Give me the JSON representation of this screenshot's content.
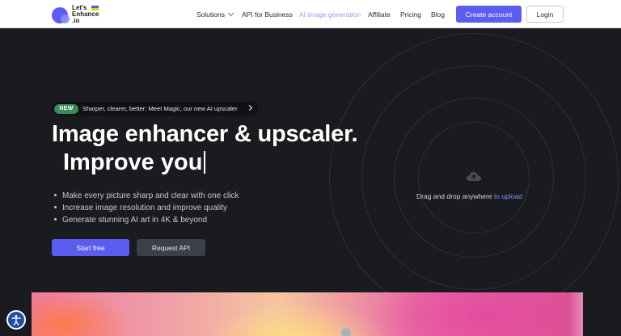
{
  "header": {
    "logo_text": "Let's Enhance .io",
    "nav": [
      {
        "label": "Solutions",
        "has_dropdown": true
      },
      {
        "label": "API for Business"
      },
      {
        "label": "AI image generation",
        "active": true
      },
      {
        "label": "Affiliate"
      },
      {
        "label": "Pricing"
      },
      {
        "label": "Blog"
      }
    ],
    "create_account": "Create account",
    "login": "Login"
  },
  "hero": {
    "badge": "NEW",
    "announcement": "Sharper, clearer, better: Meet Magic, our new AI upscaler",
    "title_line1": "Image enhancer & upscaler.",
    "title_line2": "Improve you",
    "bullets": [
      "Make every picture sharp and clear with one click",
      "Increase image resolution and improve quality",
      "Generate stunning AI art in 4K & beyond"
    ],
    "start_free": "Start free",
    "request_api": "Request API"
  },
  "upload": {
    "icon": "cloud-upload-icon",
    "text": "Drag and drop anywhere",
    "link": "to upload"
  },
  "colors": {
    "accent": "#5b5cf0",
    "background": "#1a1b1f",
    "nav_active": "#9a9bf7",
    "badge_green": "#3c8a5a"
  }
}
